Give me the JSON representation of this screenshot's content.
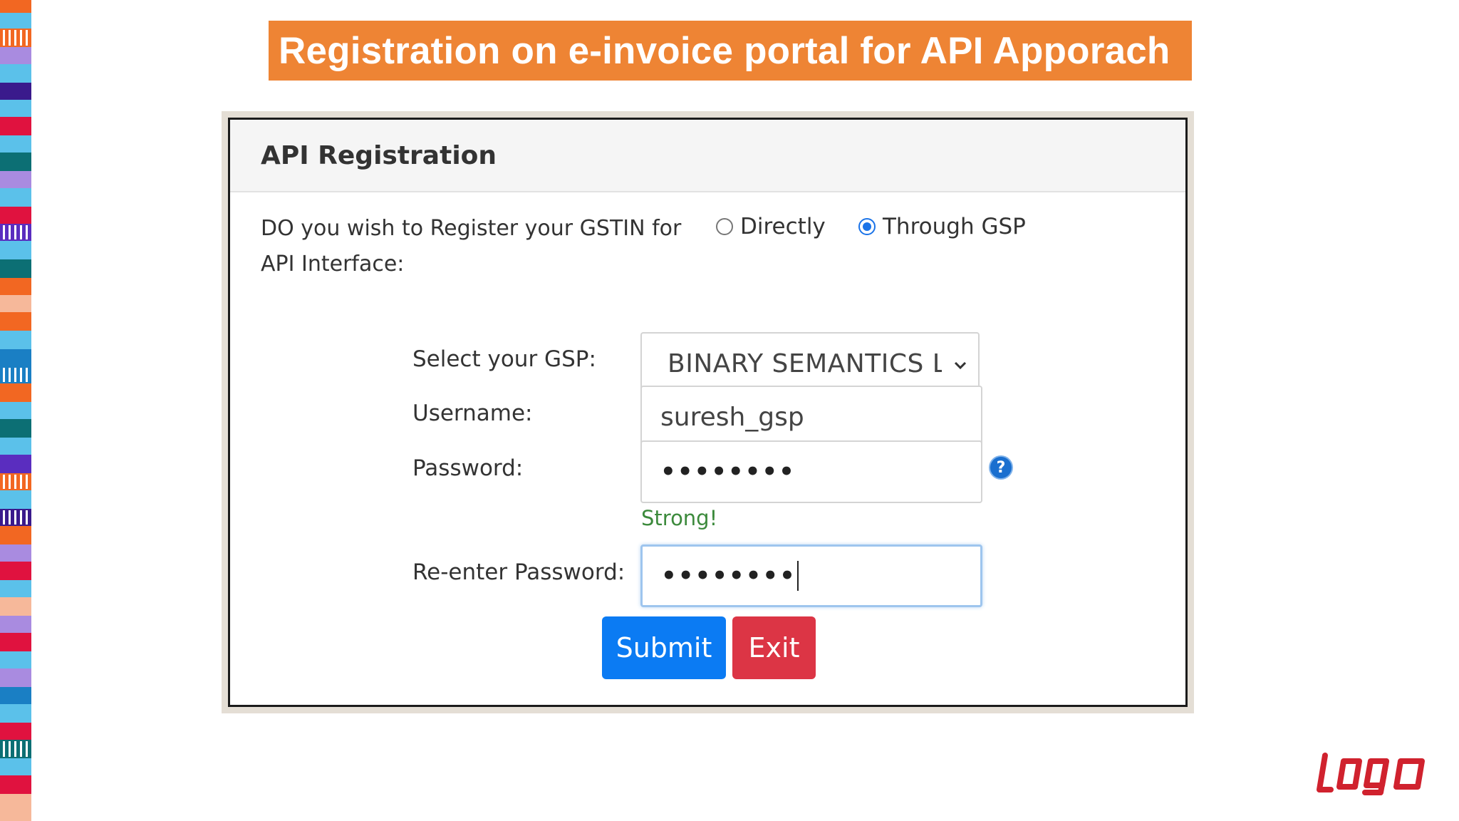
{
  "banner": {
    "title": "Registration on e-invoice portal for API Apporach"
  },
  "panel": {
    "title": "API Registration",
    "question_line1": "DO you wish to Register your GSTIN for",
    "question_line2": "API Interface:",
    "options": [
      {
        "label": "Directly",
        "selected": false
      },
      {
        "label": "Through GSP",
        "selected": true
      }
    ]
  },
  "form": {
    "gsp_label": "Select your GSP:",
    "gsp_value": "BINARY SEMANTICS LTD",
    "username_label": "Username:",
    "username_value": "suresh_gsp",
    "password_label": "Password:",
    "password_value": "••••••••",
    "strength_text": "Strong!",
    "reenter_label": "Re-enter Password:",
    "reenter_value": "••••••••"
  },
  "buttons": {
    "submit": "Submit",
    "exit": "Exit"
  },
  "colors": {
    "banner": "#ee8434",
    "submit": "#0b7bf3",
    "exit": "#dc3545",
    "logo": "#d0222e"
  }
}
